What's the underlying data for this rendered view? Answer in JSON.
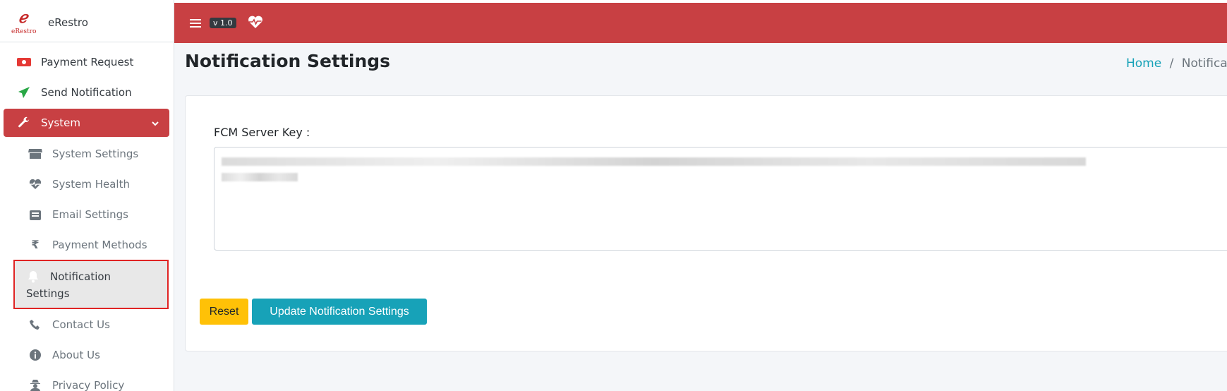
{
  "app": {
    "name": "eRestro",
    "logo_text": "eRestro"
  },
  "topbar": {
    "version": "v 1.0",
    "menu_icon": "hamburger-icon",
    "health_icon": "heartbeat-icon"
  },
  "sidebar": {
    "items": [
      {
        "label": "Payment Request",
        "icon": "money-bill-icon"
      },
      {
        "label": "Send Notification",
        "icon": "paper-plane-icon"
      },
      {
        "label": "System",
        "icon": "wrench-icon"
      }
    ],
    "sub_items": [
      {
        "label": "System Settings",
        "icon": "store-icon"
      },
      {
        "label": "System Health",
        "icon": "heartbeat-icon"
      },
      {
        "label": "Email Settings",
        "icon": "envelope-open-icon"
      },
      {
        "label": "Payment Methods",
        "icon": "rupee-icon"
      },
      {
        "label": "Notification Settings",
        "label_line1": "Notification",
        "label_line2": "Settings",
        "icon": "bell-icon"
      },
      {
        "label": "Contact Us",
        "icon": "phone-icon"
      },
      {
        "label": "About Us",
        "icon": "info-circle-icon"
      },
      {
        "label": "Privacy Policy",
        "icon": "user-secret-icon"
      }
    ]
  },
  "page": {
    "title": "Notification Settings"
  },
  "breadcrumb": {
    "home": "Home",
    "separator": "/",
    "current": "Notification Settings"
  },
  "form": {
    "fcm_label": "FCM Server Key :",
    "reset_label": "Reset",
    "update_label": "Update Notification Settings"
  },
  "colors": {
    "brand_red": "#c84043",
    "info": "#17a2b8",
    "warning": "#ffc107",
    "highlight_border": "#e02424"
  }
}
